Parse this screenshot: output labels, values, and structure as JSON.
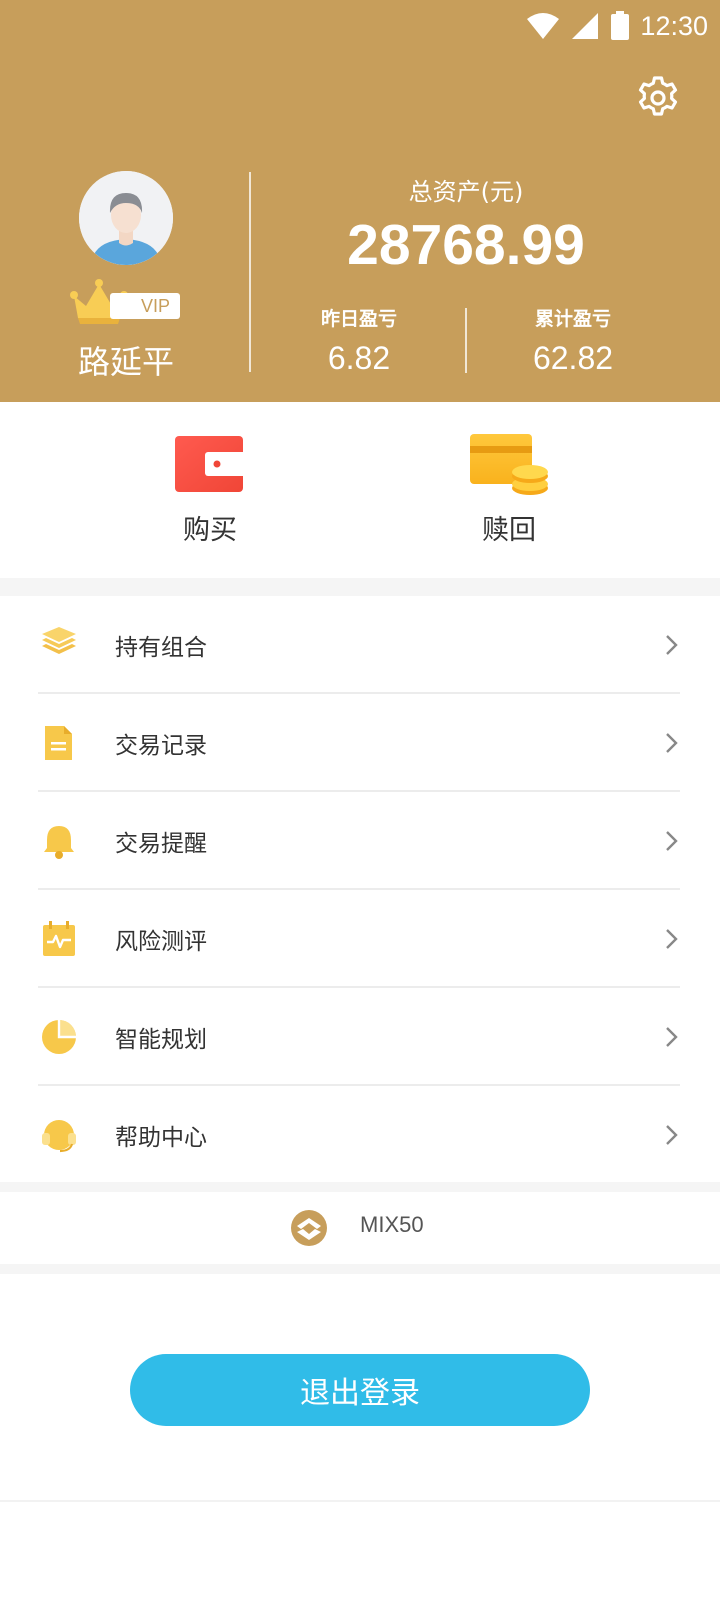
{
  "status_bar": {
    "time": "12:30"
  },
  "user": {
    "name": "路延平",
    "vip_label": "VIP"
  },
  "assets": {
    "total_label": "总资产(元)",
    "total_value": "28768.99",
    "yesterday_label": "昨日盈亏",
    "yesterday_value": "6.82",
    "cumulative_label": "累计盈亏",
    "cumulative_value": "62.82"
  },
  "actions": [
    {
      "label": "购买",
      "icon": "wallet-icon"
    },
    {
      "label": "赎回",
      "icon": "card-coins-icon"
    }
  ],
  "menu": [
    {
      "label": "持有组合",
      "icon": "layers-icon"
    },
    {
      "label": "交易记录",
      "icon": "document-icon"
    },
    {
      "label": "交易提醒",
      "icon": "bell-icon"
    },
    {
      "label": "风险测评",
      "icon": "calendar-pulse-icon"
    },
    {
      "label": "智能规划",
      "icon": "pie-chart-icon"
    },
    {
      "label": "帮助中心",
      "icon": "headset-icon"
    }
  ],
  "brand": {
    "name": "MIX50"
  },
  "logout_label": "退出登录",
  "colors": {
    "header": "#c79e5b",
    "accent_blue": "#30bce8",
    "icon_yellow": "#f7c84a"
  }
}
